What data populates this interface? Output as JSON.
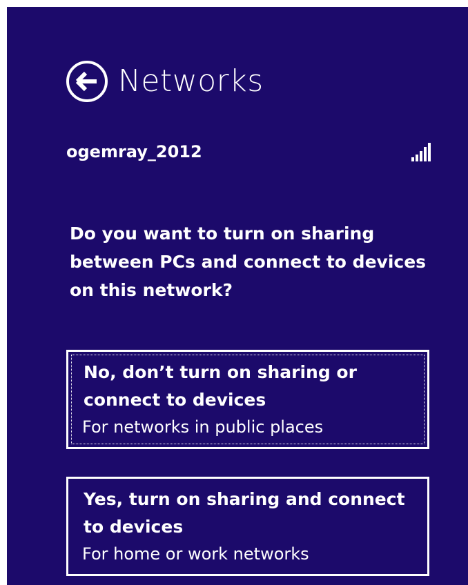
{
  "header": {
    "title": "Networks",
    "back_icon": "back-arrow-circle-icon"
  },
  "network": {
    "name": "ogemray_2012",
    "signal_icon": "wifi-signal-strength-icon",
    "signal_bars": 5
  },
  "question": "Do you want to turn on sharing between PCs and connect to devices on this network?",
  "options": [
    {
      "title": "No, don’t turn on sharing or connect to devices",
      "subtitle": "For networks in public places"
    },
    {
      "title": "Yes, turn on sharing and connect to devices",
      "subtitle": "For home or work networks"
    }
  ],
  "colors": {
    "background": "#1c0a6b",
    "foreground": "#ffffff"
  }
}
